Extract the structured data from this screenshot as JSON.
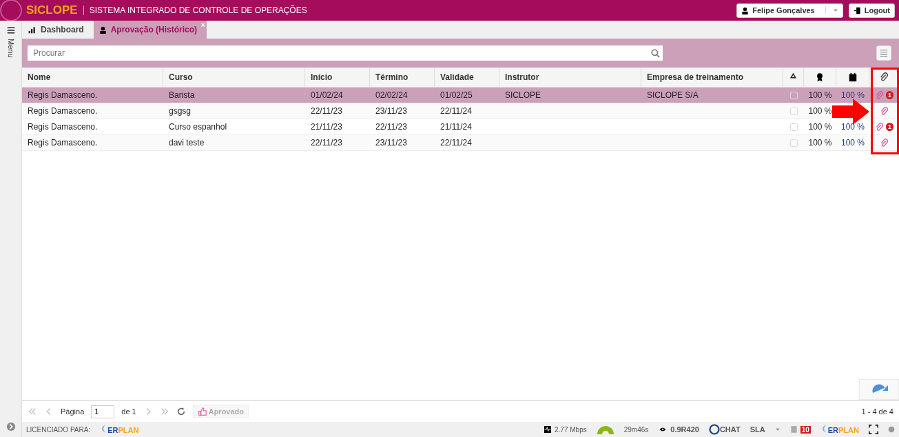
{
  "header": {
    "logo": "SICLOPE",
    "title": "SISTEMA INTEGRADO DE CONTROLE DE OPERAÇÕES",
    "user": "Felipe Gonçalves",
    "logout": "Logout"
  },
  "sidebar": {
    "label": "Menu"
  },
  "tabs": [
    {
      "label": "Dashboard",
      "selected": false
    },
    {
      "label": "Aprovação (Histórico)",
      "selected": true,
      "close": "×"
    }
  ],
  "search": {
    "placeholder": "Procurar"
  },
  "table": {
    "columns": [
      "Nome",
      "Curso",
      "Início",
      "Término",
      "Validade",
      "Instrutor",
      "Empresa de treinamento"
    ],
    "rows": [
      {
        "cells": [
          "Regis Damasceno.",
          "Barista",
          "01/02/24",
          "02/02/24",
          "01/02/25",
          "SICLOPE",
          "SICLOPE S/A"
        ],
        "selected": true,
        "checked": false,
        "percent_1": "100 %",
        "percent_2": "100 %",
        "badge": "1"
      },
      {
        "cells": [
          "Regis Damasceno.",
          "gsgsg",
          "22/11/23",
          "23/11/23",
          "22/11/24",
          "",
          ""
        ],
        "selected": false,
        "checked": false,
        "percent_1": "100 %"
      },
      {
        "cells": [
          "Regis Damasceno.",
          "Curso espanhol",
          "21/11/23",
          "22/11/23",
          "21/11/24",
          "",
          ""
        ],
        "selected": false,
        "checked": false,
        "percent_1": "100 %",
        "percent_2": "100 %",
        "badge": "1"
      },
      {
        "cells": [
          "Regis Damasceno.",
          "davi teste",
          "22/11/23",
          "23/11/23",
          "22/11/24",
          "",
          ""
        ],
        "selected": false,
        "checked": false,
        "percent_1": "100 %",
        "percent_2": "100 %"
      }
    ]
  },
  "pager": {
    "page_label": "Página",
    "page": "1",
    "of": "de 1",
    "approved": "Aprovado",
    "range": "1 - 4 de 4"
  },
  "status_bar": {
    "licensed": "LICENCIADO PARA:",
    "brand_left": [
      "ER",
      "PLAN"
    ],
    "brand_right": [
      "ER",
      "PLAN"
    ],
    "speed": "2.77 Mbps",
    "timer": "29m46s",
    "version": "0.9R420",
    "chat": "CHAT",
    "sla": "SLA",
    "count": "10"
  },
  "annotations": {
    "highlight_box": true,
    "arrow": true
  }
}
